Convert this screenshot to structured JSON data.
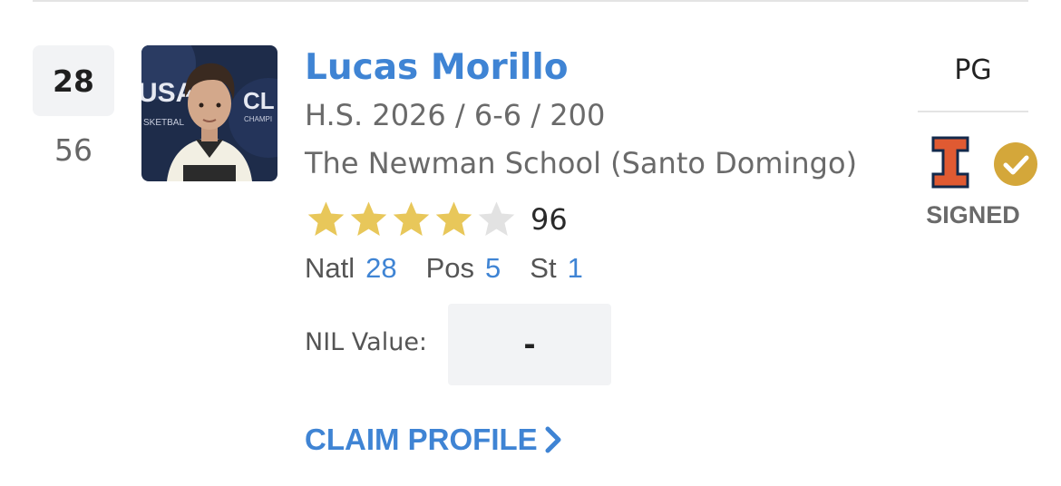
{
  "player": {
    "rank": "28",
    "previous_rank": "56",
    "name": "Lucas Morillo",
    "meta": "H.S. 2026 / 6-6 / 200",
    "school": "The Newman School (Santo Domingo)",
    "stars_filled": 4,
    "stars_total": 5,
    "rating": "96",
    "position": "PG"
  },
  "photo": {
    "backdrop_text_left": "USA",
    "backdrop_text_small": "SKETBAL",
    "backdrop_text_right": "CL",
    "backdrop_text_right_small": "CHAMPI"
  },
  "rankings": {
    "natl_label": "Natl",
    "natl_value": "28",
    "pos_label": "Pos",
    "pos_value": "5",
    "st_label": "St",
    "st_value": "1"
  },
  "nil": {
    "label": "NIL Value:",
    "value": "-"
  },
  "claim": {
    "label": "CLAIM PROFILE"
  },
  "commitment": {
    "status": "SIGNED",
    "school_logo": "I",
    "logo_color": "#e05a32",
    "check_color": "#d4a73a"
  },
  "colors": {
    "accent": "#3f84d4",
    "star_filled": "#e8c75a",
    "star_empty": "#e2e2e2"
  },
  "icons": {
    "star": "star-icon",
    "chevron": "chevron-right-icon",
    "check": "check-circle-icon",
    "school_logo": "illinois-logo-icon"
  }
}
